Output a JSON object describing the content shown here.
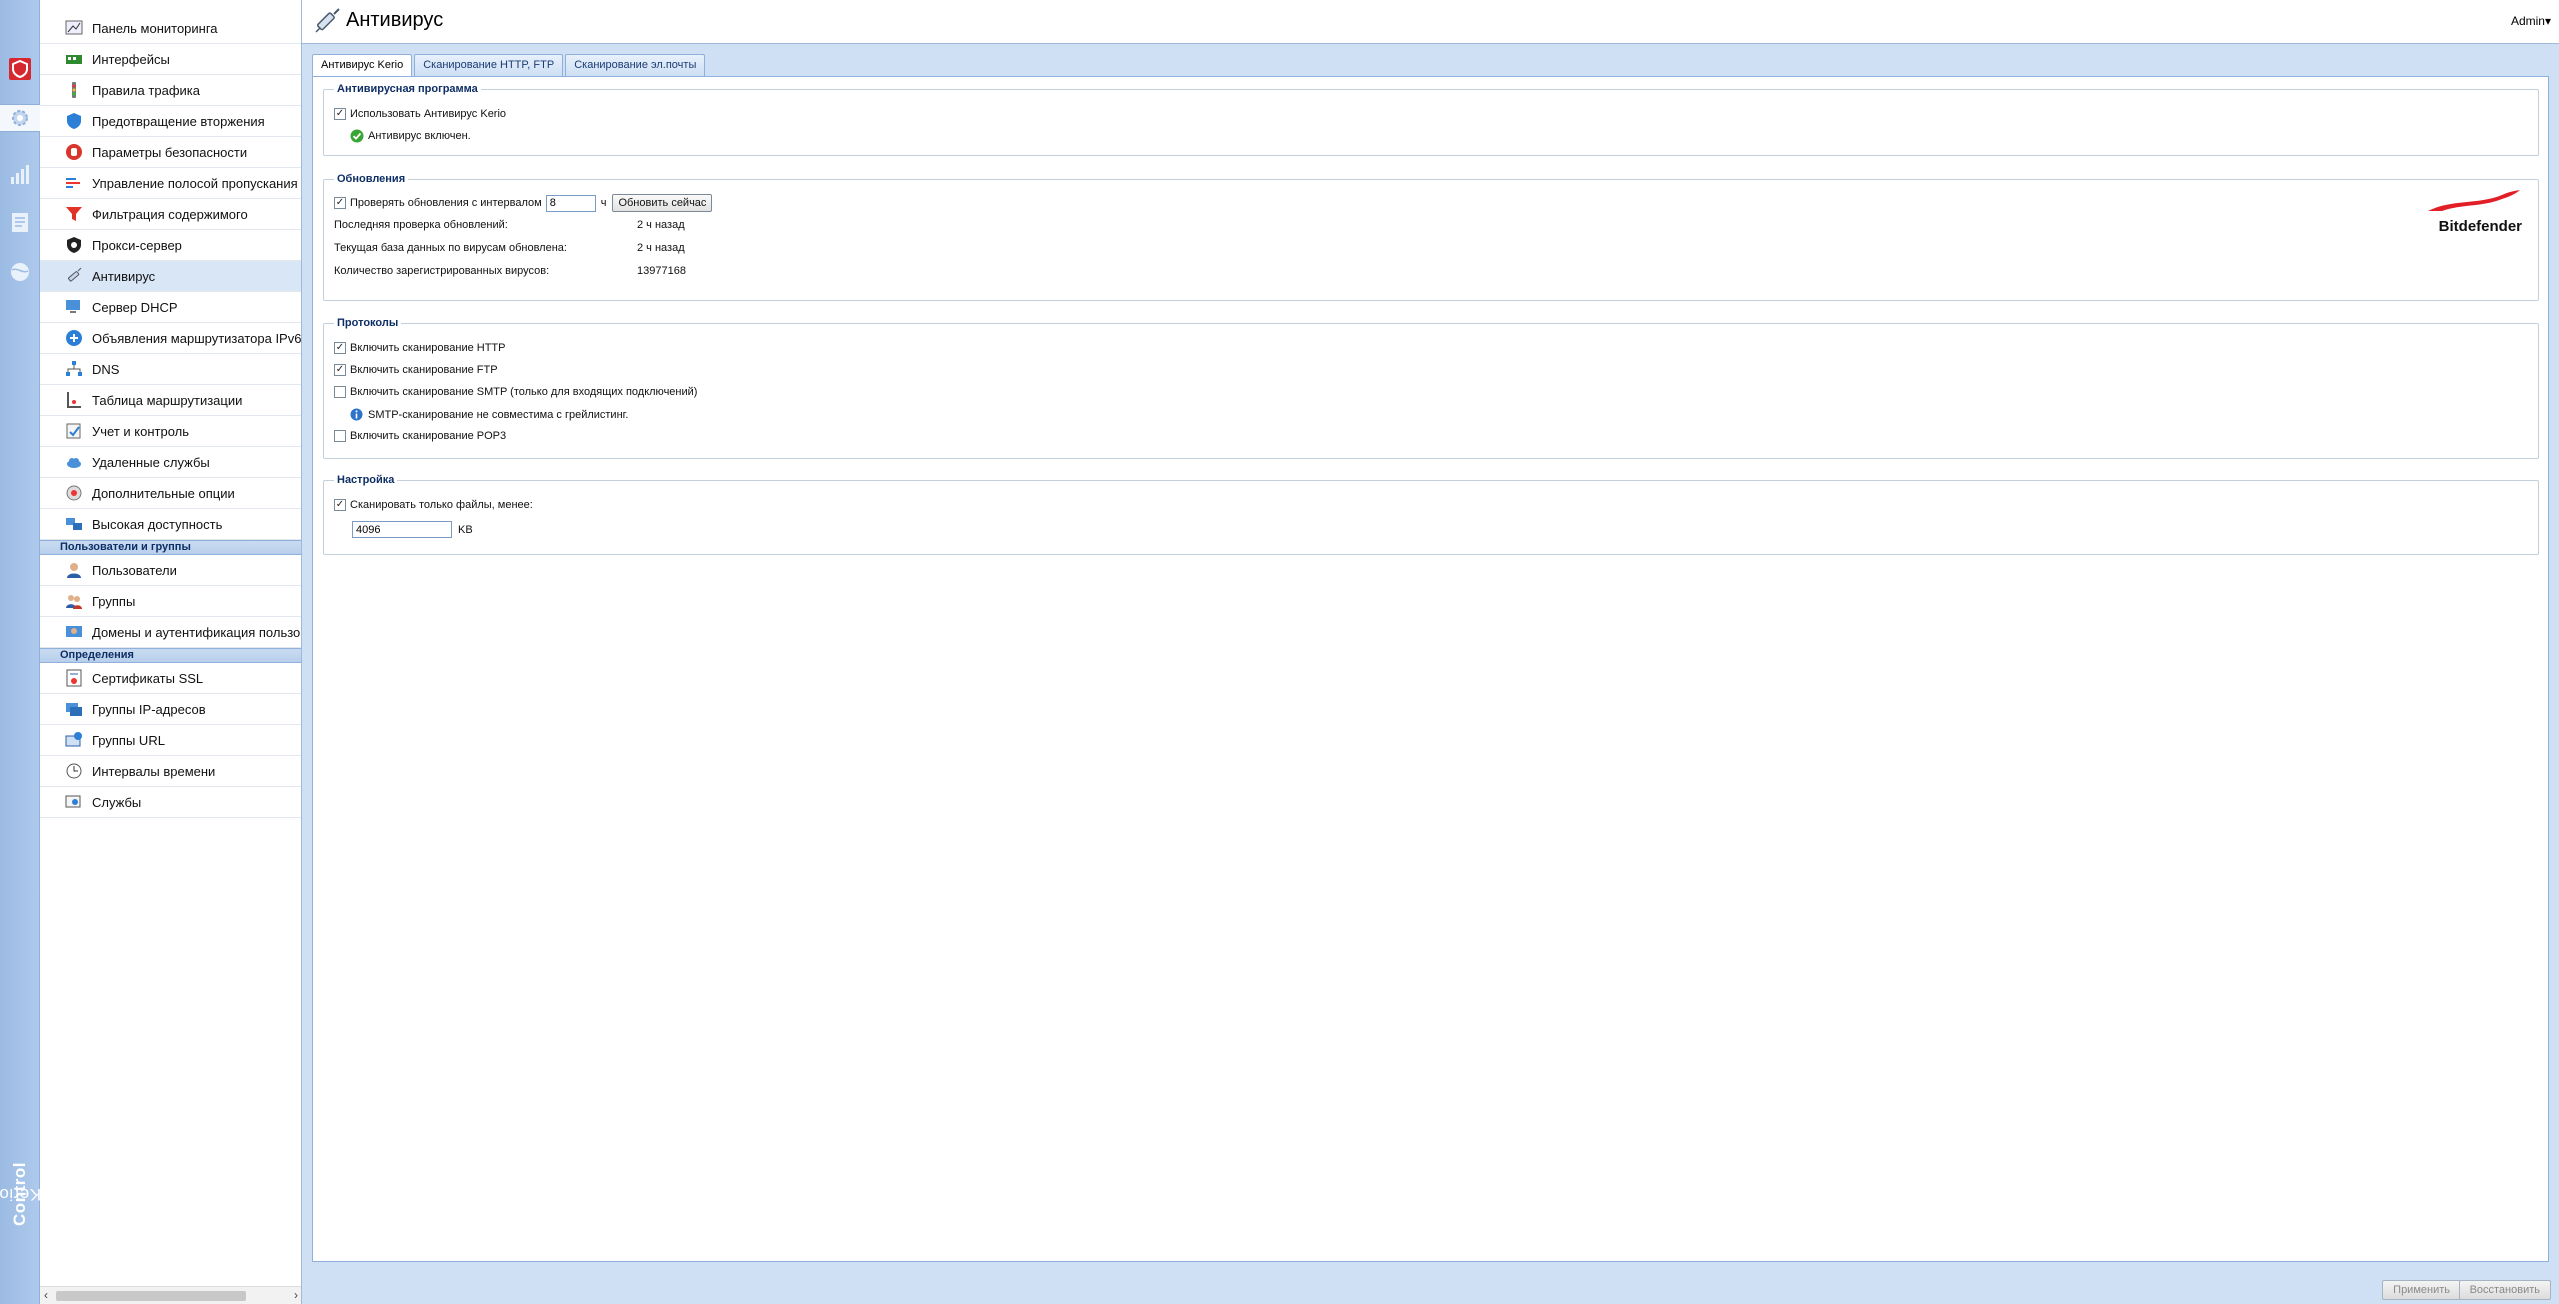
{
  "rail": {
    "brand_prefix": "Kerio",
    "brand_suffix": "Control",
    "buttons": [
      {
        "icon": "shield-logo-icon"
      },
      {
        "icon": "gear-icon"
      },
      {
        "icon": "bar-chart-icon"
      },
      {
        "icon": "log-document-icon"
      },
      {
        "icon": "globe-icon"
      }
    ]
  },
  "nav": {
    "items": [
      {
        "label": "Панель мониторинга",
        "icon": "dashboard-icon"
      },
      {
        "label": "Интерфейсы",
        "icon": "interfaces-icon"
      },
      {
        "label": "Правила трафика",
        "icon": "traffic-rules-icon"
      },
      {
        "label": "Предотвращение вторжения",
        "icon": "intrusion-shield-icon"
      },
      {
        "label": "Параметры безопасности",
        "icon": "security-hand-icon"
      },
      {
        "label": "Управление полосой пропускания и",
        "icon": "bandwidth-icon"
      },
      {
        "label": "Фильтрация содержимого",
        "icon": "filter-funnel-icon"
      },
      {
        "label": "Прокси-сервер",
        "icon": "proxy-icon"
      },
      {
        "label": "Антивирус",
        "icon": "antivirus-syringe-icon"
      },
      {
        "label": "Сервер DHCP",
        "icon": "dhcp-server-icon"
      },
      {
        "label": "Объявления маршрутизатора IPv6",
        "icon": "ipv6-router-icon"
      },
      {
        "label": "DNS",
        "icon": "dns-icon"
      },
      {
        "label": "Таблица маршрутизации",
        "icon": "routing-table-icon"
      },
      {
        "label": "Учет и контроль",
        "icon": "accounting-icon"
      },
      {
        "label": "Удаленные службы",
        "icon": "cloud-services-icon"
      },
      {
        "label": "Дополнительные опции",
        "icon": "advanced-options-icon"
      },
      {
        "label": "Высокая доступность",
        "icon": "high-availability-icon"
      }
    ],
    "section_users": "Пользователи и группы",
    "users_items": [
      {
        "label": "Пользователи",
        "icon": "user-icon"
      },
      {
        "label": "Группы",
        "icon": "group-icon"
      },
      {
        "label": "Домены и аутентификация пользова",
        "icon": "domain-auth-icon"
      }
    ],
    "section_definitions": "Определения",
    "definition_items": [
      {
        "label": "Сертификаты SSL",
        "icon": "certificate-icon"
      },
      {
        "label": "Группы IP-адресов",
        "icon": "ip-group-icon"
      },
      {
        "label": "Группы URL",
        "icon": "url-group-icon"
      },
      {
        "label": "Интервалы времени",
        "icon": "clock-icon"
      },
      {
        "label": "Службы",
        "icon": "services-icon"
      }
    ]
  },
  "header": {
    "title": "Антивирус",
    "user_menu": "Admin"
  },
  "tabs": [
    {
      "label": "Антивирус Kerio",
      "active": true
    },
    {
      "label": "Сканирование HTTP, FTP",
      "active": false
    },
    {
      "label": "Сканирование эл.почты",
      "active": false
    }
  ],
  "antivirus_program": {
    "legend": "Антивирусная программа",
    "use_kerio_label": "Использовать Антивирус Kerio",
    "use_kerio_checked": true,
    "status_text": "Антивирус включен."
  },
  "updates": {
    "legend": "Обновления",
    "check_label": "Проверять обновления с интервалом",
    "check_checked": true,
    "interval_value": "8",
    "interval_unit": "ч",
    "update_now_button": "Обновить сейчас",
    "last_check_label": "Последняя проверка обновлений:",
    "last_check_value": "2 ч назад",
    "db_updated_label": "Текущая база данных по вирусам обновлена:",
    "db_updated_value": "2 ч назад",
    "virus_count_label": "Количество зарегистрированных вирусов:",
    "virus_count_value": "13977168",
    "vendor_logo": "Bitdefender",
    "vendor_color": "#e21f26"
  },
  "protocols": {
    "legend": "Протоколы",
    "http_label": "Включить сканирование HTTP",
    "http_checked": true,
    "ftp_label": "Включить сканирование FTP",
    "ftp_checked": true,
    "smtp_label": "Включить сканирование SMTP (только для входящих подключений)",
    "smtp_checked": false,
    "smtp_note": "SMTP-сканирование не совместима с грейлистинг.",
    "pop3_label": "Включить сканирование POP3",
    "pop3_checked": false
  },
  "settings": {
    "legend": "Настройка",
    "scan_limit_label": "Сканировать только файлы, менее:",
    "scan_limit_checked": true,
    "size_value": "4096",
    "size_unit": "KB"
  },
  "footer": {
    "apply_button": "Применить",
    "restore_button": "Восстановить"
  },
  "colors": {
    "accent": "#0e2f66",
    "rail": "#9bbbe3",
    "background": "#cfe0f4"
  }
}
